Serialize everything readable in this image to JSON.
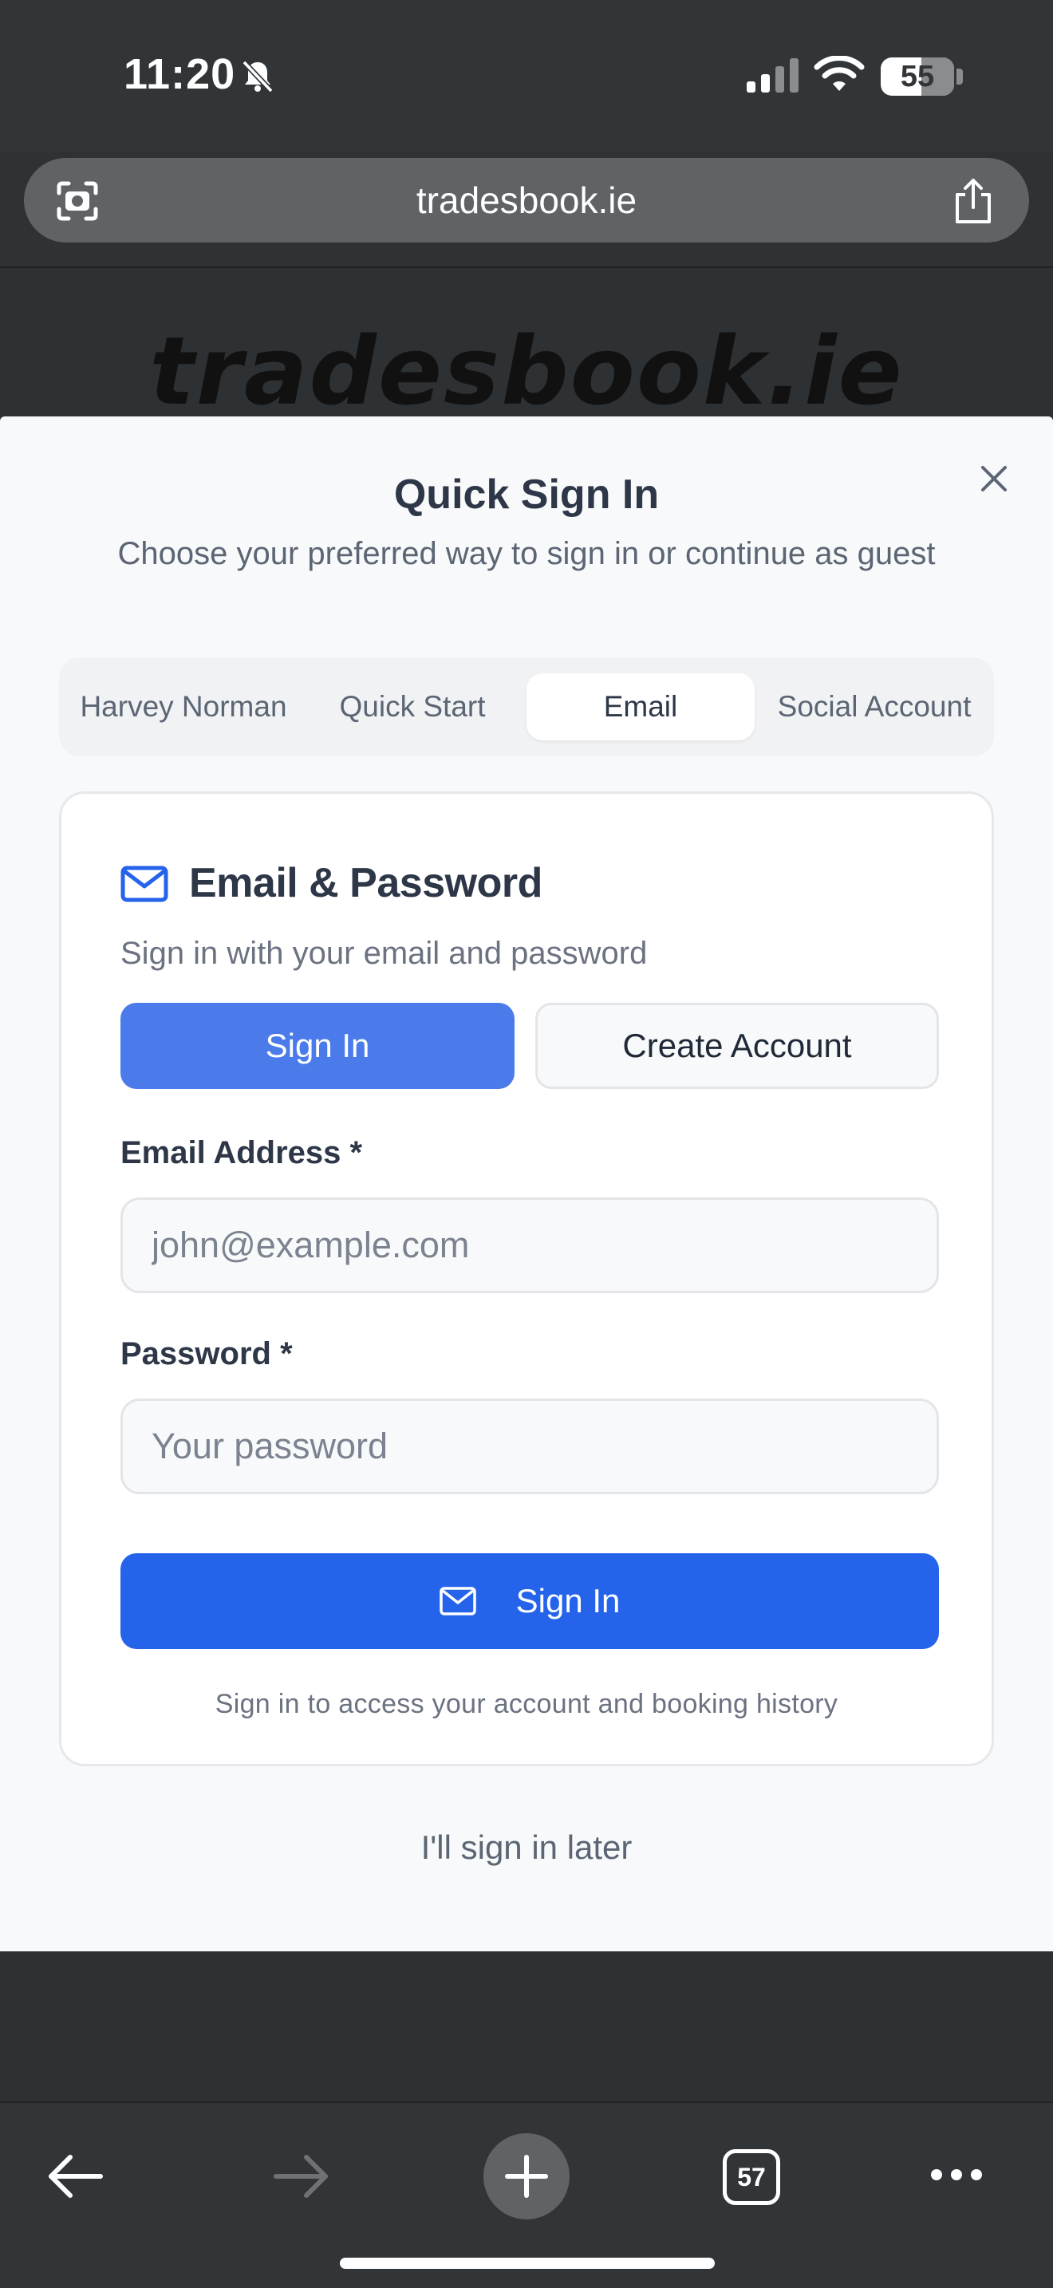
{
  "status_bar": {
    "time": "11:20",
    "battery": "55",
    "battery_level_percent": 55
  },
  "browser": {
    "url": "tradesbook.ie",
    "tab_count": "57"
  },
  "page": {
    "logo": "tradesbook.ie"
  },
  "modal": {
    "title": "Quick Sign In",
    "subtitle": "Choose your preferred way to sign in or continue as guest",
    "tabs": [
      {
        "label": "Harvey Norman",
        "active": false
      },
      {
        "label": "Quick Start",
        "active": false
      },
      {
        "label": "Email",
        "active": true
      },
      {
        "label": "Social Account",
        "active": false
      }
    ],
    "card": {
      "title": "Email & Password",
      "subtitle": "Sign in with your email and password",
      "mode_signin_label": "Sign In",
      "mode_create_label": "Create Account",
      "email_label": "Email Address",
      "email_placeholder": "john@example.com",
      "email_value": "",
      "password_label": "Password",
      "password_placeholder": "Your password",
      "password_value": "",
      "required_marker": "*",
      "submit_label": "Sign In",
      "footnote": "Sign in to access your account and booking history"
    },
    "later_link": "I'll sign in later"
  },
  "colors": {
    "primary": "#2563eb",
    "primary_light": "#4b7bea",
    "chrome_dark": "#323538"
  },
  "icons": [
    "bell-slash-icon",
    "signal-icon",
    "wifi-icon",
    "camera-scan-icon",
    "share-icon",
    "close-icon",
    "mail-icon",
    "back-arrow-icon",
    "forward-arrow-icon",
    "plus-icon",
    "more-icon"
  ]
}
